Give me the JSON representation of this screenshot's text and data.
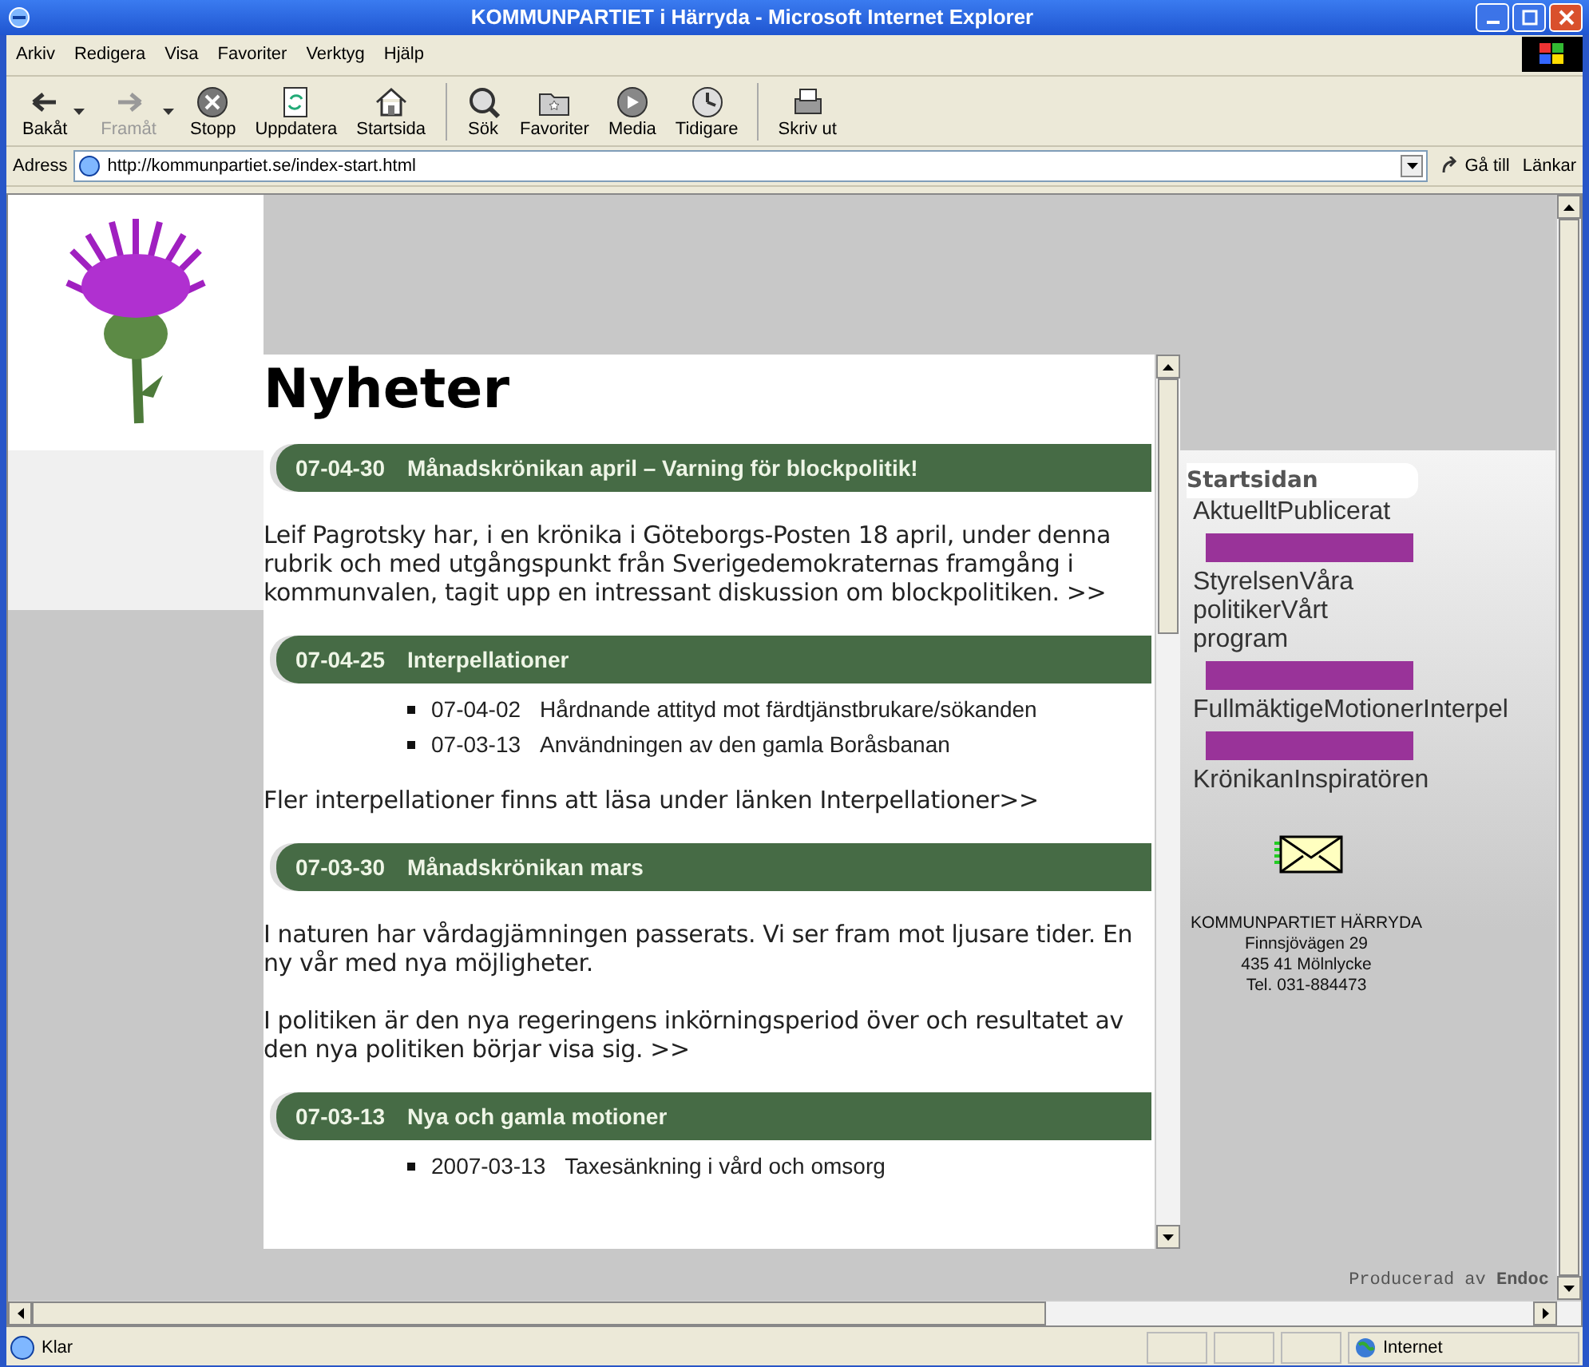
{
  "window": {
    "title": "KOMMUNPARTIET i Härryda - Microsoft Internet Explorer"
  },
  "menu": [
    "Arkiv",
    "Redigera",
    "Visa",
    "Favoriter",
    "Verktyg",
    "Hjälp"
  ],
  "toolbar": [
    {
      "label": "Bakåt",
      "kind": "back",
      "disabled": false,
      "dropdown": true
    },
    {
      "label": "Framåt",
      "kind": "forward",
      "disabled": true,
      "dropdown": true
    },
    {
      "label": "Stopp",
      "kind": "stop",
      "disabled": false,
      "dropdown": false
    },
    {
      "label": "Uppdatera",
      "kind": "refresh",
      "disabled": false,
      "dropdown": false
    },
    {
      "label": "Startsida",
      "kind": "home",
      "disabled": false,
      "dropdown": false
    },
    {
      "label": "Sök",
      "kind": "search",
      "disabled": false,
      "dropdown": false
    },
    {
      "label": "Favoriter",
      "kind": "favorites",
      "disabled": false,
      "dropdown": false
    },
    {
      "label": "Media",
      "kind": "media",
      "disabled": false,
      "dropdown": false
    },
    {
      "label": "Tidigare",
      "kind": "history",
      "disabled": false,
      "dropdown": false
    },
    {
      "label": "Skriv ut",
      "kind": "print",
      "disabled": false,
      "dropdown": false
    }
  ],
  "address": {
    "label": "Adress",
    "value": "http://kommunpartiet.se/index-start.html",
    "go": "Gå till",
    "links": "Länkar"
  },
  "page": {
    "heading": "Nyheter",
    "news": [
      {
        "date": "07-04-30",
        "title": "Månadskrönikan april – Varning för blockpolitik!",
        "body": [
          {
            "kind": "paragraph",
            "text": "Leif Pagrotsky har, i en krönika i Göteborgs-Posten 18 april, under denna rubrik och med utgångspunkt från Sverigedemokraternas framgång i kommunvalen, tagit upp en intressant diskussion om blockpolitiken. >>"
          }
        ]
      },
      {
        "date": "07-04-25",
        "title": "Interpellationer",
        "body": [
          {
            "kind": "list",
            "items": [
              {
                "date": "07-04-02",
                "text": "Hårdnande attityd mot färdtjänstbrukare/sökanden"
              },
              {
                "date": "07-03-13",
                "text": "Användningen av den gamla Boråsbanan"
              }
            ]
          },
          {
            "kind": "paragraph",
            "text": "Fler interpellationer finns att läsa under länken Interpellationer>>"
          }
        ]
      },
      {
        "date": "07-03-30",
        "title": "Månadskrönikan mars",
        "body": [
          {
            "kind": "paragraph",
            "text": "I naturen har vårdagjämningen passerats. Vi ser fram mot ljusare tider. En ny vår med nya möjligheter."
          },
          {
            "kind": "paragraph",
            "text": "I politiken är den nya regeringens inkörningsperiod över och resultatet av den nya politiken börjar visa sig. >>"
          }
        ]
      },
      {
        "date": "07-03-13",
        "title": "Nya och gamla motioner",
        "body": [
          {
            "kind": "list",
            "items": [
              {
                "date": "2007-03-13",
                "text": "Taxesänkning i vård och omsorg"
              }
            ]
          }
        ]
      }
    ]
  },
  "sidebar": {
    "tab": "Startsidan",
    "groups": [
      "AktuelltPublicerat",
      "StyrelsenVåra politikerVårt program",
      "FullmäktigeMotionerInterpel",
      "KrönikanInspiratören"
    ],
    "contact": [
      "KOMMUNPARTIET  HÄRRYDA",
      "Finnsjövägen 29",
      "435 41 Mölnlycke",
      "Tel. 031-884473"
    ]
  },
  "footer": "Producerad av **Endoc**",
  "status_bar": {
    "text": "Klar",
    "zone": "Internet"
  }
}
